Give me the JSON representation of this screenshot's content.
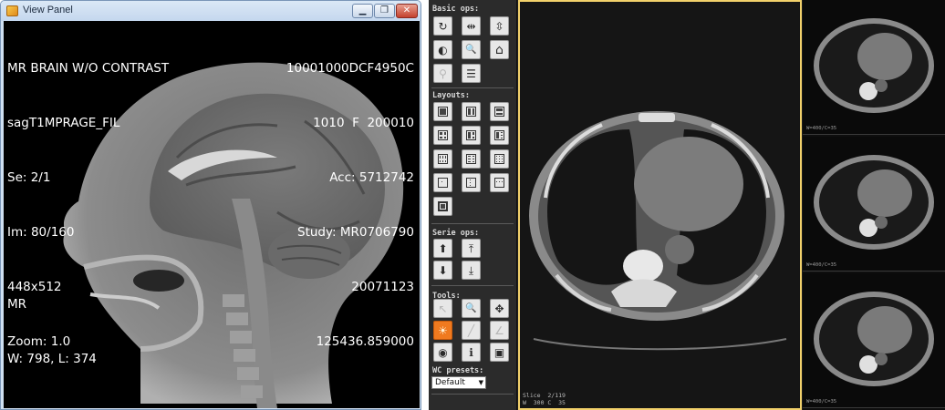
{
  "window": {
    "title": "View Panel",
    "minimize_glyph": "▁",
    "maximize_glyph": "❐",
    "close_glyph": "✕"
  },
  "mr": {
    "top_left": [
      "MR BRAIN W/O CONTRAST",
      "sagT1MPRAGE_FIL",
      "Se: 2/1",
      "Im: 80/160",
      "448x512",
      "Zoom: 1.0"
    ],
    "top_right": [
      "10001000DCF4950C",
      "1010  F  200010",
      "Acc: 5712742",
      "Study: MR0706790",
      "20071123",
      "125436.859000"
    ],
    "bottom_left": [
      "MR",
      "W: 798, L: 374"
    ]
  },
  "viewer": {
    "sections": {
      "basic": "Basic ops:",
      "layouts": "Layouts:",
      "serie": "Serie ops:",
      "tools": "Tools:",
      "wc": "WC presets:"
    },
    "basic_ops": [
      {
        "icon": "refresh-icon",
        "glyph": "↻"
      },
      {
        "icon": "flip-horizontal-icon",
        "glyph": "⇹"
      },
      {
        "icon": "flip-vertical-icon",
        "glyph": "⇳"
      },
      {
        "icon": "invert-icon",
        "glyph": "◐"
      },
      {
        "icon": "zoom-icon",
        "glyph": "🔍"
      },
      {
        "icon": "reset-icon",
        "glyph": "⌂"
      },
      {
        "icon": "magnifier-disabled-icon",
        "glyph": "⚲"
      },
      {
        "icon": "layers-icon",
        "glyph": "☰"
      }
    ],
    "serie_ops": [
      {
        "icon": "arrow-up-icon",
        "glyph": "⬆"
      },
      {
        "icon": "arrow-top-icon",
        "glyph": "⤒"
      },
      {
        "icon": "arrow-down-icon",
        "glyph": "⬇"
      },
      {
        "icon": "arrow-bottom-icon",
        "glyph": "⤓"
      }
    ],
    "tools": [
      {
        "icon": "pointer-icon",
        "glyph": "↖",
        "state": "disabled"
      },
      {
        "icon": "zoom-tool-icon",
        "glyph": "🔍",
        "state": "normal"
      },
      {
        "icon": "pan-icon",
        "glyph": "✥",
        "state": "normal"
      },
      {
        "icon": "window-level-icon",
        "glyph": "☀",
        "state": "active"
      },
      {
        "icon": "line-measure-icon",
        "glyph": "╱",
        "state": "disabled"
      },
      {
        "icon": "angle-measure-icon",
        "glyph": "∠",
        "state": "disabled"
      },
      {
        "icon": "eye-icon",
        "glyph": "◉",
        "state": "normal"
      },
      {
        "icon": "info-icon",
        "glyph": "ℹ",
        "state": "normal"
      },
      {
        "icon": "screenshot-icon",
        "glyph": "▣",
        "state": "normal"
      }
    ],
    "wc_selected": "Default",
    "main_overlay": [
      "Slice  2/119",
      "W  300 C  35"
    ],
    "thumb_overlay": "W=400/C=35"
  },
  "colors": {
    "active_border": "#f2d16b",
    "active_tool": "#f07a1f"
  }
}
